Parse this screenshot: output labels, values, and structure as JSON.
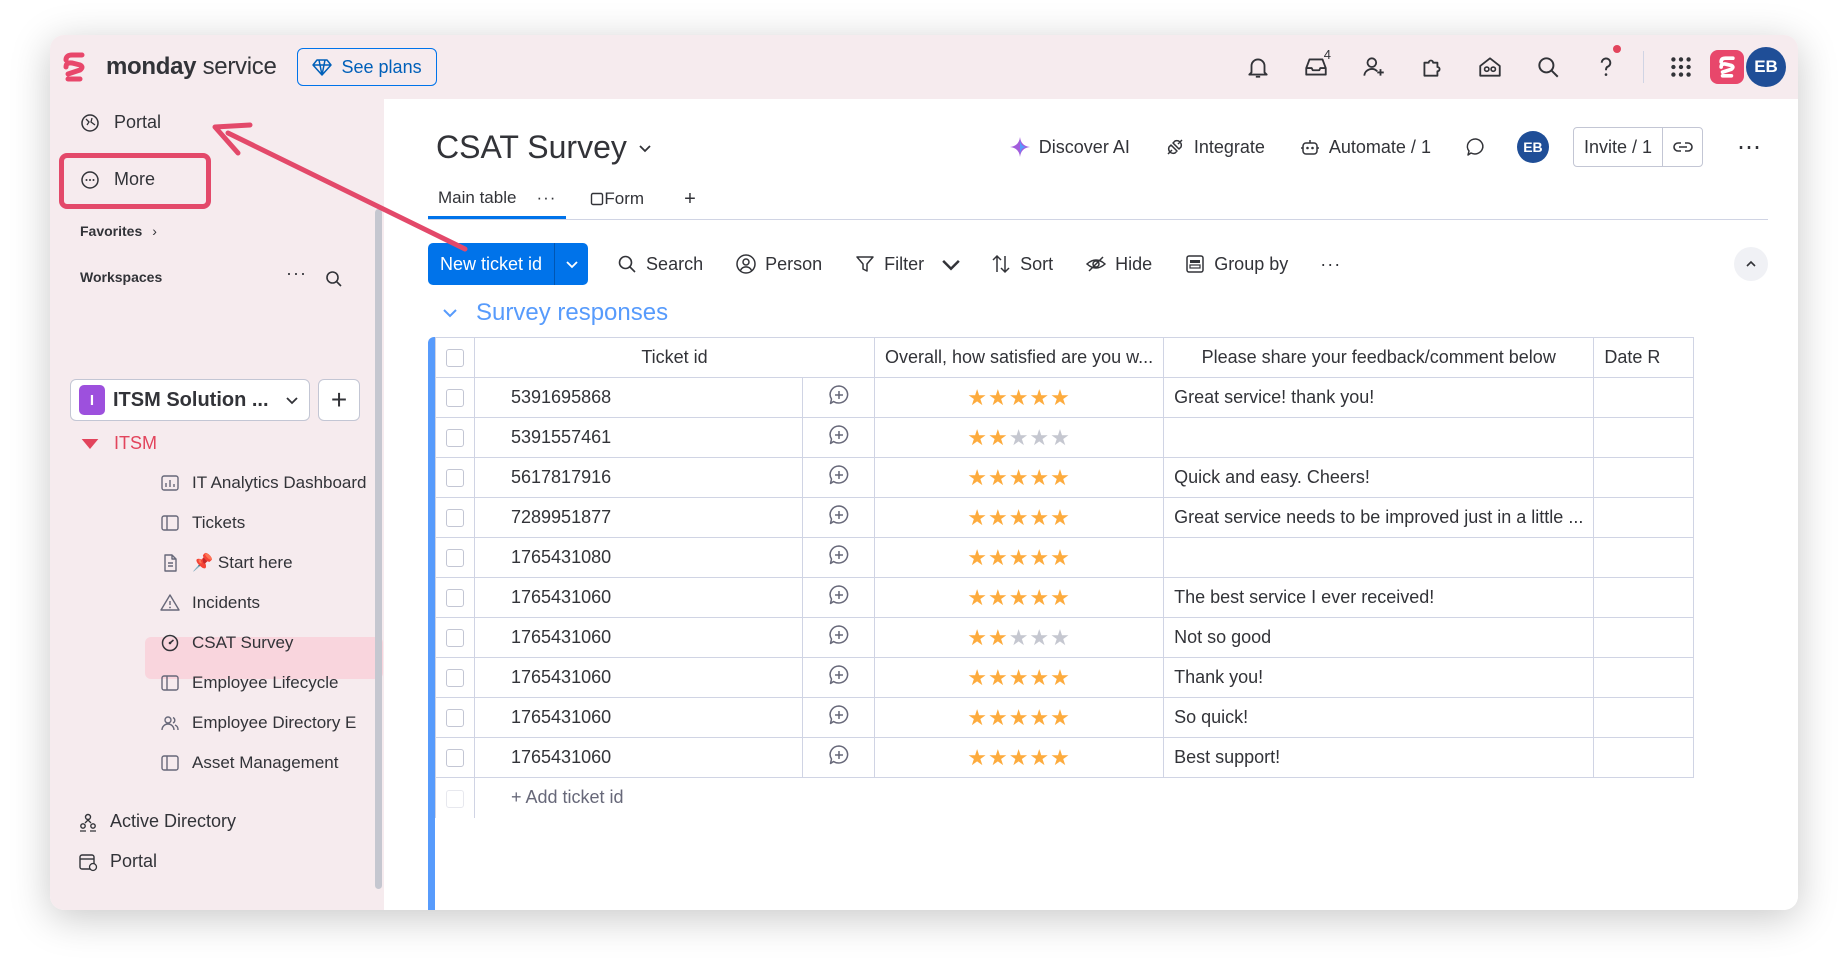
{
  "app": {
    "brand_bold": "monday",
    "brand_light": " service",
    "see_plans": "See plans",
    "inbox_count": "4",
    "avatar": "EB"
  },
  "sidebar": {
    "portal": "Portal",
    "more": "More",
    "favorites": "Favorites",
    "workspaces": "Workspaces",
    "workspace_name": "ITSM Solution ...",
    "workspace_icon": "I",
    "folder": "ITSM",
    "boards": [
      {
        "label": "IT Analytics Dashboard",
        "icon": "dashboard-icon"
      },
      {
        "label": "Tickets",
        "icon": "board-icon"
      },
      {
        "label": "📌 Start here",
        "icon": "doc-icon"
      },
      {
        "label": "Incidents",
        "icon": "warning-icon"
      },
      {
        "label": "CSAT Survey",
        "icon": "gauge-icon"
      },
      {
        "label": "Employee Lifecycle",
        "icon": "board-icon"
      },
      {
        "label": "Employee Directory E",
        "icon": "people-icon"
      },
      {
        "label": "Asset Management",
        "icon": "board-icon"
      }
    ],
    "active_directory": "Active Directory",
    "portal_bottom": "Portal"
  },
  "board": {
    "title": "CSAT Survey",
    "discover_ai": "Discover AI",
    "integrate": "Integrate",
    "automate": "Automate / 1",
    "avatar": "EB",
    "invite": "Invite / 1",
    "tabs": [
      "Main table",
      "Form"
    ],
    "new_item": "New ticket id",
    "toolbar": {
      "search": "Search",
      "person": "Person",
      "filter": "Filter",
      "sort": "Sort",
      "hide": "Hide",
      "group_by": "Group by"
    },
    "group": "Survey responses",
    "columns": [
      "Ticket id",
      "Overall, how satisfied are you w...",
      "Please share your feedback/comment below",
      "Date R"
    ],
    "rows": [
      {
        "id": "5391695868",
        "rating": 5,
        "feedback": "Great service! thank you!"
      },
      {
        "id": "5391557461",
        "rating": 2,
        "feedback": ""
      },
      {
        "id": "5617817916",
        "rating": 5,
        "feedback": "Quick and easy. Cheers!"
      },
      {
        "id": "7289951877",
        "rating": 5,
        "feedback": "Great service needs to be improved just in a little ..."
      },
      {
        "id": "1765431080",
        "rating": 5,
        "feedback": ""
      },
      {
        "id": "1765431060",
        "rating": 5,
        "feedback": "The best service I ever received!"
      },
      {
        "id": "1765431060",
        "rating": 2,
        "feedback": "Not so good"
      },
      {
        "id": "1765431060",
        "rating": 5,
        "feedback": "Thank you!"
      },
      {
        "id": "1765431060",
        "rating": 5,
        "feedback": "So quick!"
      },
      {
        "id": "1765431060",
        "rating": 5,
        "feedback": "Best support!"
      }
    ],
    "add_row": "+ Add ticket id"
  },
  "colors": {
    "accent": "#0073ea",
    "highlight": "#e3496a",
    "group": "#579bfc",
    "star": "#fdab3d"
  }
}
